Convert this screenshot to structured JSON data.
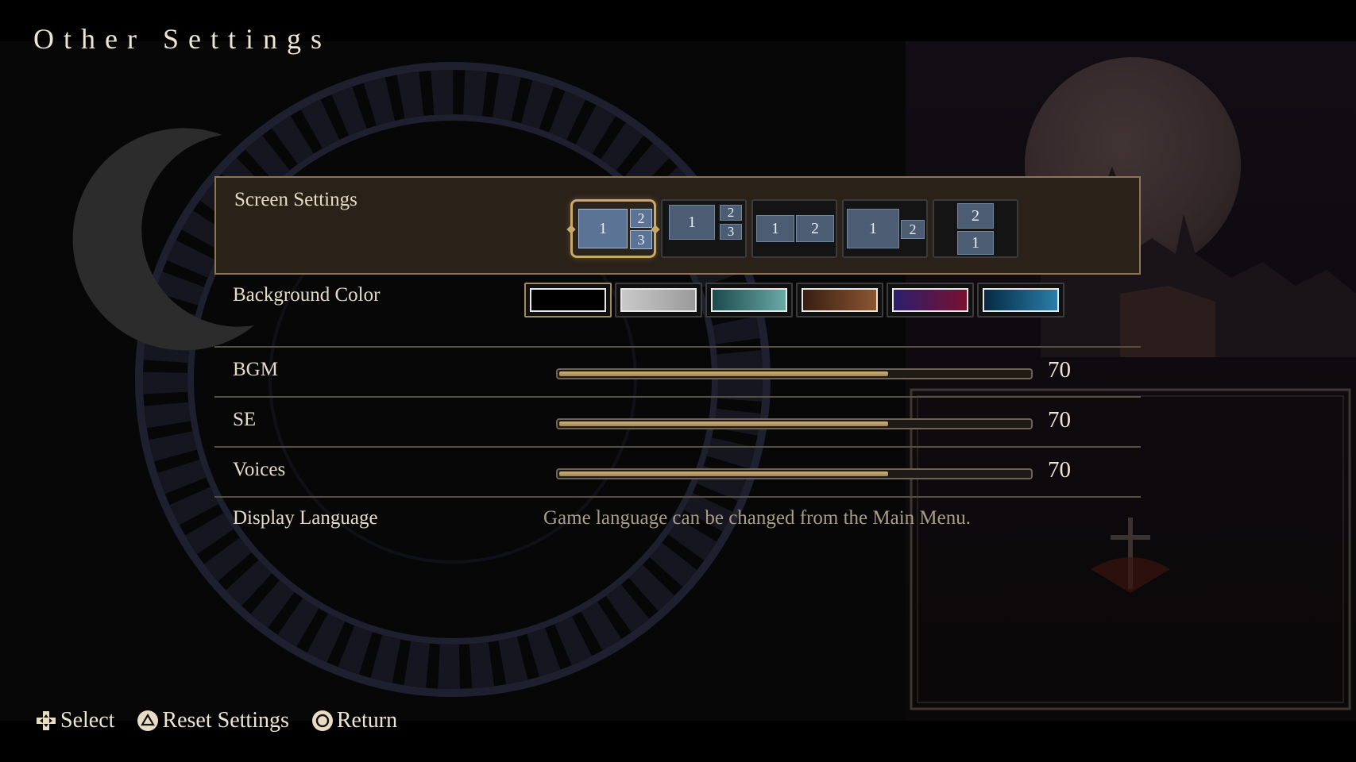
{
  "title": "Other Settings",
  "screen_settings": {
    "label": "Screen Settings",
    "selected_index": 0,
    "layouts": [
      {
        "name": "main-with-two-side",
        "tiles": [
          "1",
          "2",
          "3"
        ]
      },
      {
        "name": "main-with-two-side-small",
        "tiles": [
          "1",
          "2",
          "3"
        ]
      },
      {
        "name": "two-equal",
        "tiles": [
          "1",
          "2"
        ]
      },
      {
        "name": "main-with-one-side",
        "tiles": [
          "1",
          "2"
        ]
      },
      {
        "name": "stacked",
        "tiles": [
          "2",
          "1"
        ]
      }
    ]
  },
  "background_color": {
    "label": "Background Color",
    "selected_index": 0,
    "swatches": [
      {
        "name": "black",
        "gradient": [
          "#000000",
          "#000000"
        ]
      },
      {
        "name": "gray",
        "gradient": [
          "#c9c9c9",
          "#9a9a9a"
        ]
      },
      {
        "name": "teal",
        "gradient": [
          "#1c4a4c",
          "#6aa9a6"
        ]
      },
      {
        "name": "brown",
        "gradient": [
          "#3a1e12",
          "#8a5632"
        ]
      },
      {
        "name": "purple-red",
        "gradient": [
          "#2a1f6e",
          "#7a1030"
        ]
      },
      {
        "name": "blue",
        "gradient": [
          "#062a44",
          "#2a7ea8"
        ]
      }
    ]
  },
  "bgm": {
    "label": "BGM",
    "value": "70",
    "level": 0.7
  },
  "se": {
    "label": "SE",
    "value": "70",
    "level": 0.7
  },
  "voices": {
    "label": "Voices",
    "value": "70",
    "level": 0.7
  },
  "display_language": {
    "label": "Display Language",
    "note": "Game language can be changed from the Main Menu."
  },
  "footer": {
    "select_label": "Select",
    "reset_label": "Reset Settings",
    "return_label": "Return"
  },
  "colors": {
    "accent": "#c9a96a",
    "panel": "#2a2119",
    "text": "#e6dcc6"
  }
}
